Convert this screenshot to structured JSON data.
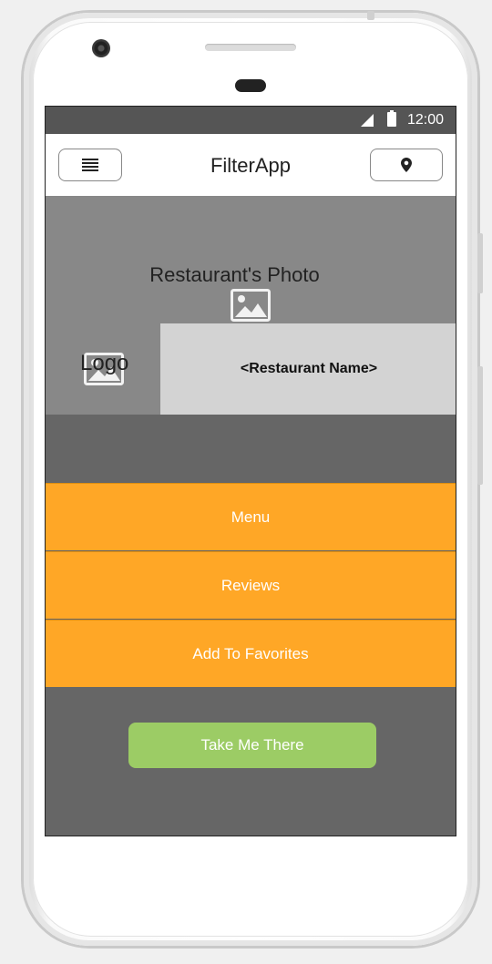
{
  "status": {
    "time": "12:00",
    "icons": [
      "signal-icon",
      "battery-icon"
    ]
  },
  "appbar": {
    "title": "FilterApp",
    "menu_icon": "hamburger-icon",
    "location_icon": "location-pin-icon"
  },
  "restaurant": {
    "photo_label": "Restaurant's Photo",
    "photo_icon": "image-icon",
    "logo_label": "Logo",
    "logo_icon": "image-icon",
    "name": "<Restaurant Name>"
  },
  "actions": [
    {
      "label": "Menu"
    },
    {
      "label": "Reviews"
    },
    {
      "label": "Add To Favorites"
    }
  ],
  "cta": {
    "label": "Take Me There"
  },
  "colors": {
    "status_bar": "#555555",
    "hero_bg": "#888888",
    "name_bg": "#d3d3d3",
    "screen_bg": "#666666",
    "action_bg": "#ffa726",
    "cta_bg": "#9ccc65"
  }
}
